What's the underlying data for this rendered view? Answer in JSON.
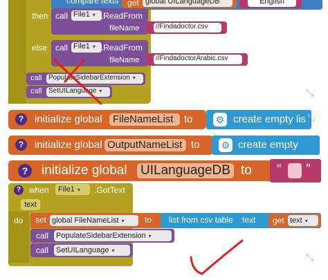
{
  "top_block": {
    "compare_label": "compare texts",
    "get_label": "get",
    "global_var": "global UILanguageDB",
    "value_english": "English",
    "then_label": "then",
    "else_label": "else",
    "call_label": "call",
    "file_component": "File1",
    "method_readfrom": ".ReadFrom",
    "param_filename": "fileName",
    "file_value_1": "//Findadoctor.csv",
    "file_value_2": "//FindadoctorArabic.csv",
    "proc_populate": "PopulateSidebarExtension",
    "proc_setui": "SetUILanguage"
  },
  "init_blocks": [
    {
      "q": "?",
      "label": "initialize global",
      "name": "FileNameList",
      "to": "to",
      "value": "create empty lis"
    },
    {
      "q": "?",
      "label": "initialize global",
      "name": "OutputNameList",
      "to": "to",
      "value": "create empty"
    },
    {
      "q": "?",
      "label": "initialize global",
      "name": "UILanguageDB",
      "to": "to",
      "open_quote": "“",
      "close_quote": "”"
    }
  ],
  "event_block": {
    "q": "?",
    "when_label": "when",
    "component": "File1",
    "event": ".GotText",
    "param": "text",
    "do_label": "do",
    "set_label": "set",
    "set_var": "global FileNameList",
    "to_label": "to",
    "list_from_csv": "list from csv table",
    "text_label": "text",
    "get_label": "get",
    "get_value": "text",
    "call_label": "call",
    "proc_populate": "PopulateSidebarExtension",
    "proc_setui": "SetUILanguage"
  },
  "icons": {
    "gear": "gear-icon",
    "dropdown": "dropdown-arrow-icon",
    "resize": "resize-corner-icon",
    "help": "help-icon"
  },
  "colors": {
    "control": "#b5a222",
    "procedure": "#7d4f99",
    "text": "#b7396a",
    "variable": "#d76527",
    "list": "#2f9ad2",
    "help": "#4a2b86",
    "annotation": "#e02020"
  }
}
